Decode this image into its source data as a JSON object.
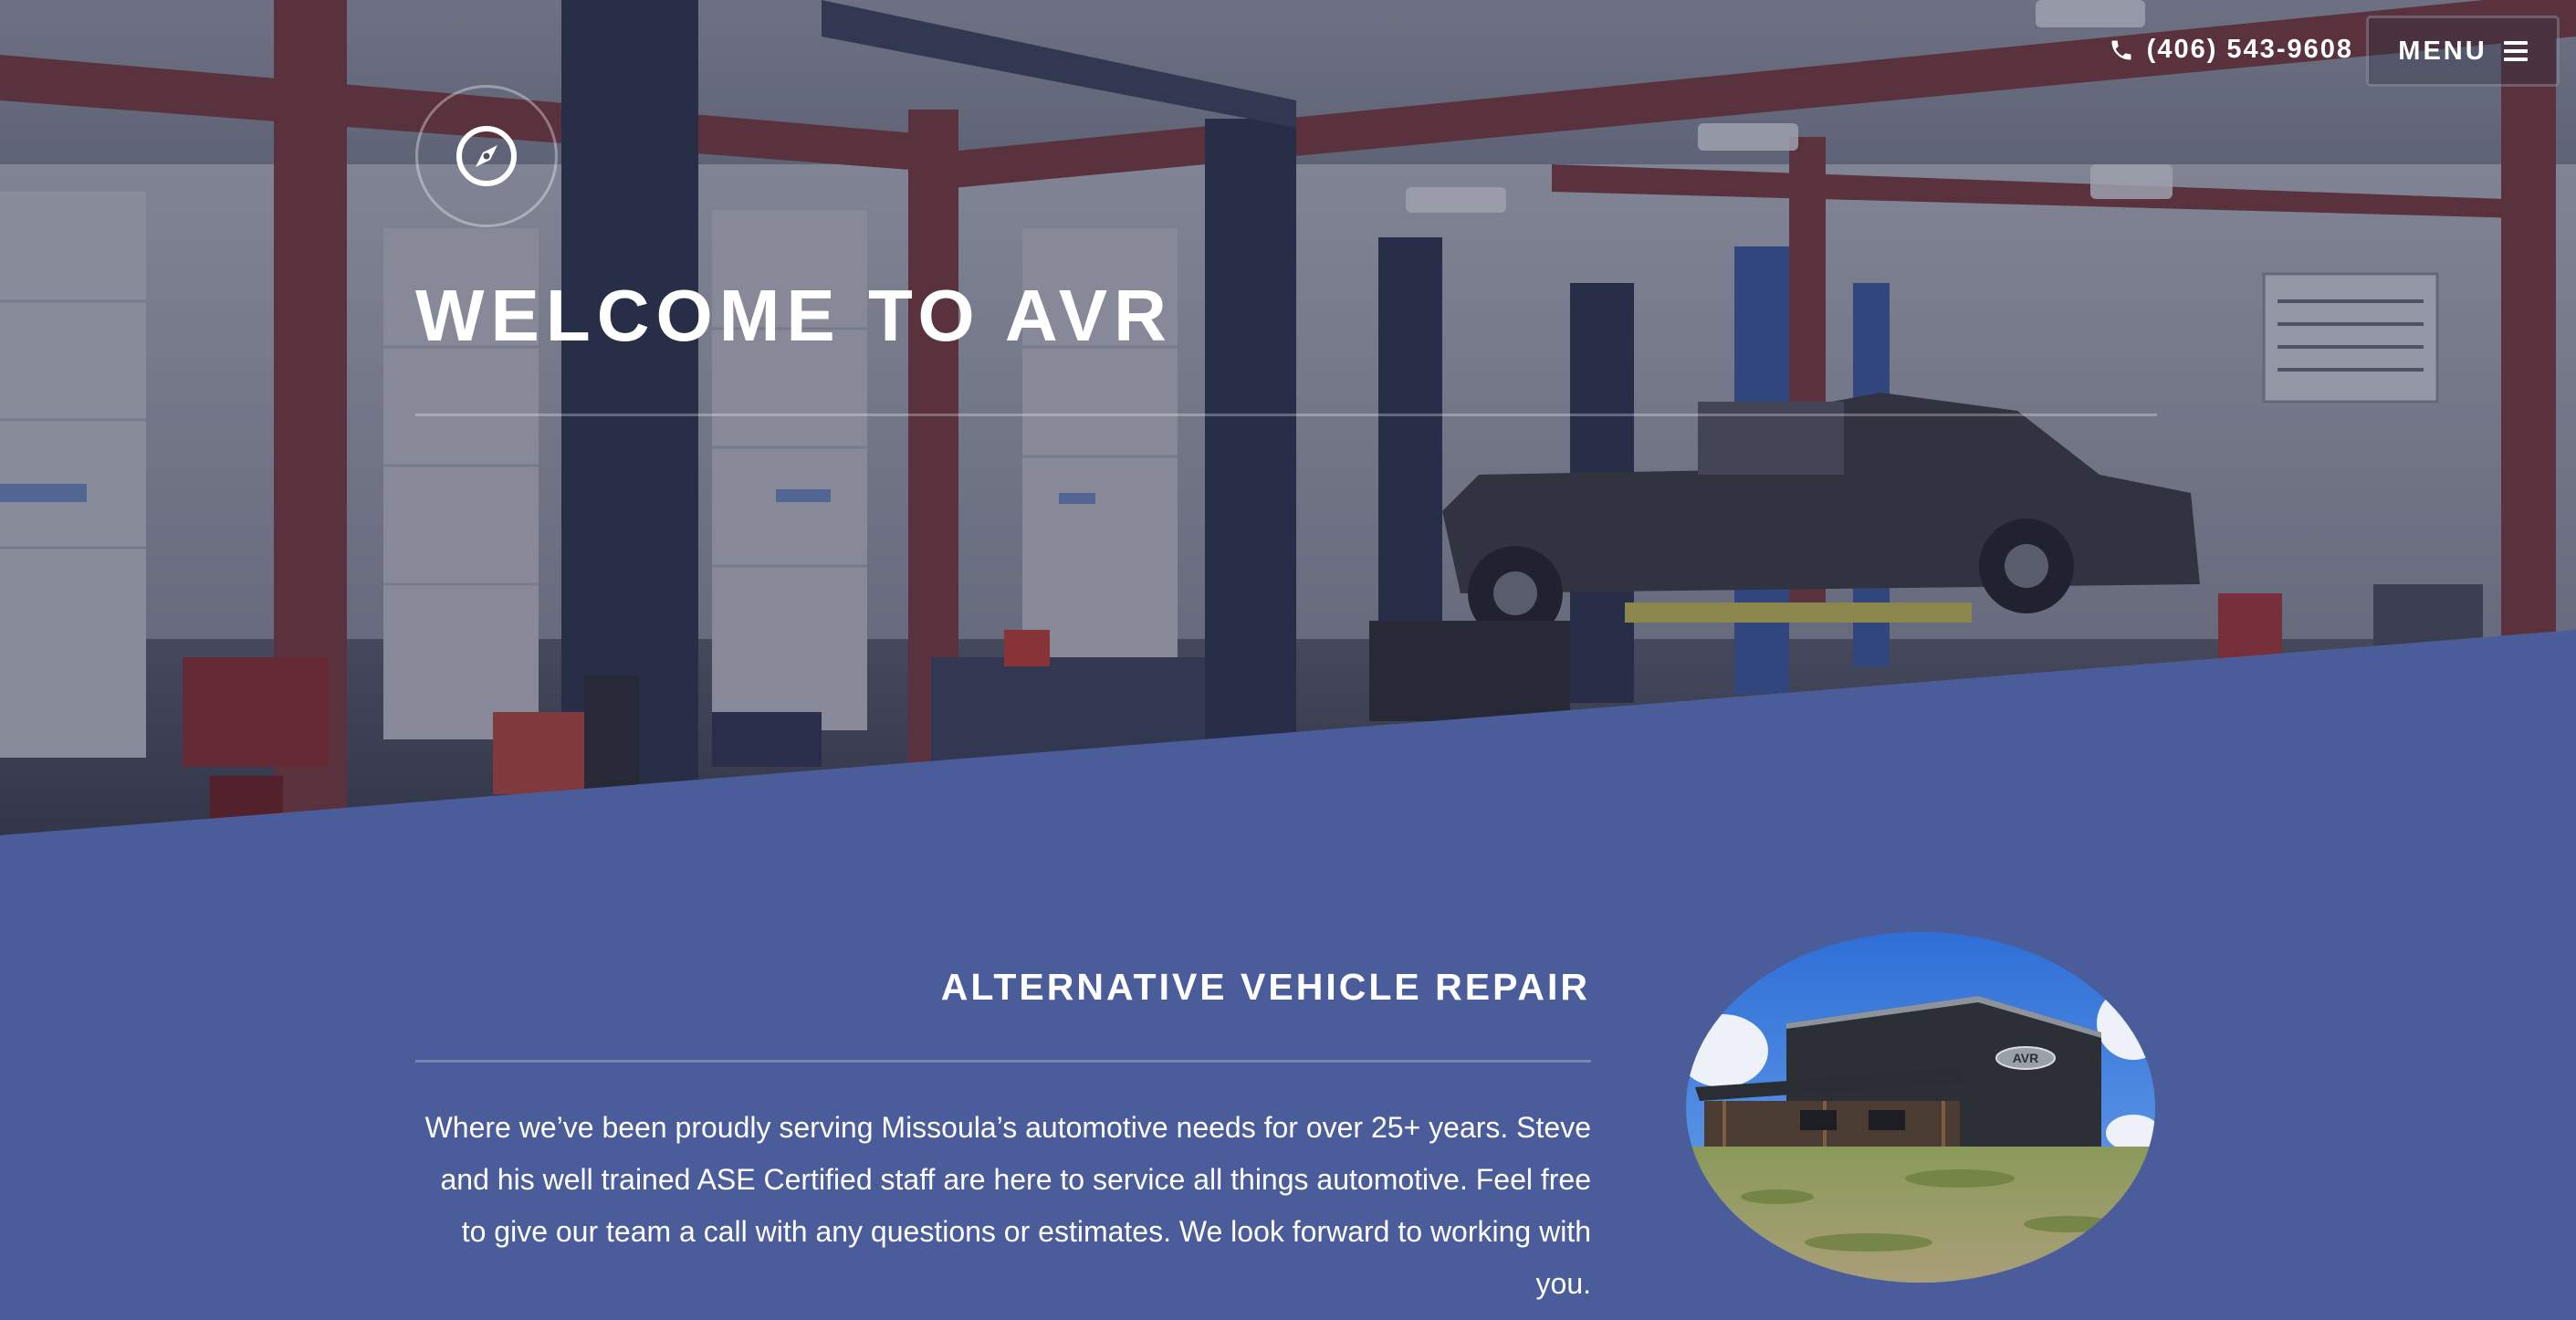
{
  "header": {
    "phone": "(406) 543-9608",
    "menu_label": "MENU",
    "phone_icon": "phone-icon",
    "menu_icon": "hamburger-icon"
  },
  "hero": {
    "logo_icon": "compass-icon",
    "title": "WELCOME TO AVR"
  },
  "about": {
    "heading": "ALTERNATIVE VEHICLE REPAIR",
    "body": "Where we’ve been proudly serving Missoula’s automotive needs for over 25+ years. Steve and his well trained ASE Certified staff are here to service all things automotive. Feel free to give our team a call with any questions or estimates. We look forward to working with you.",
    "building_sign": "AVR"
  },
  "colors": {
    "section_background": "#4b5c9a",
    "text": "#ffffff"
  }
}
